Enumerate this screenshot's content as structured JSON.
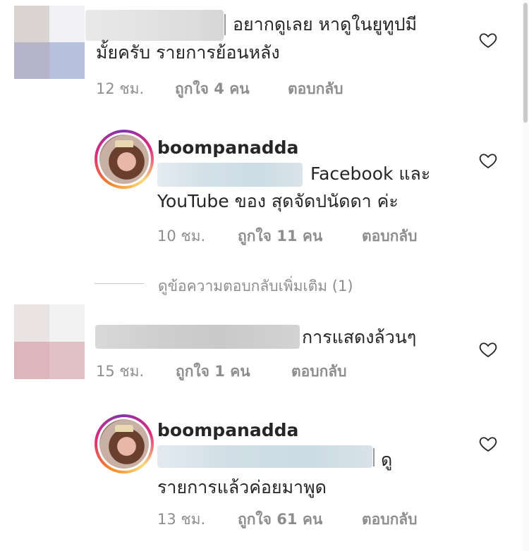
{
  "comments": [
    {
      "text_line1": "อยากดูเลย หาดูในยูทูปมี",
      "text_line2": "มั้ยครับ รายการย้อนหลัง",
      "time": "12 ชม.",
      "likes": "ถูกใจ 4 คน",
      "reply": "ตอบกลับ"
    },
    {
      "username": "boompanadda",
      "text_line1": "Facebook และ",
      "text_line2": "YouTube ของ สุดจัดปนัดดา ค่ะ",
      "time": "10 ชม.",
      "likes": "ถูกใจ 11 คน",
      "reply": "ตอบกลับ"
    },
    {
      "text_line1": "การแสดงล้วนๆ",
      "time": "15 ชม.",
      "likes": "ถูกใจ 1 คน",
      "reply": "ตอบกลับ"
    },
    {
      "username": "boompanadda",
      "text_line1": "ดู",
      "text_line2": "รายการแล้วค่อยมาพูด",
      "time": "13 ชม.",
      "likes": "ถูกใจ 61 คน",
      "reply": "ตอบกลับ"
    }
  ],
  "view_more_replies": "ดูข้อความตอบกลับเพิ่มเติม (1)",
  "icons": {
    "like": "heart-outline-icon"
  },
  "colors": {
    "text": "#262626",
    "meta": "#8e8e8e",
    "divider": "#c7c7c7",
    "avatar_ring_start": "#f58529",
    "avatar_ring_end": "#8134af"
  }
}
